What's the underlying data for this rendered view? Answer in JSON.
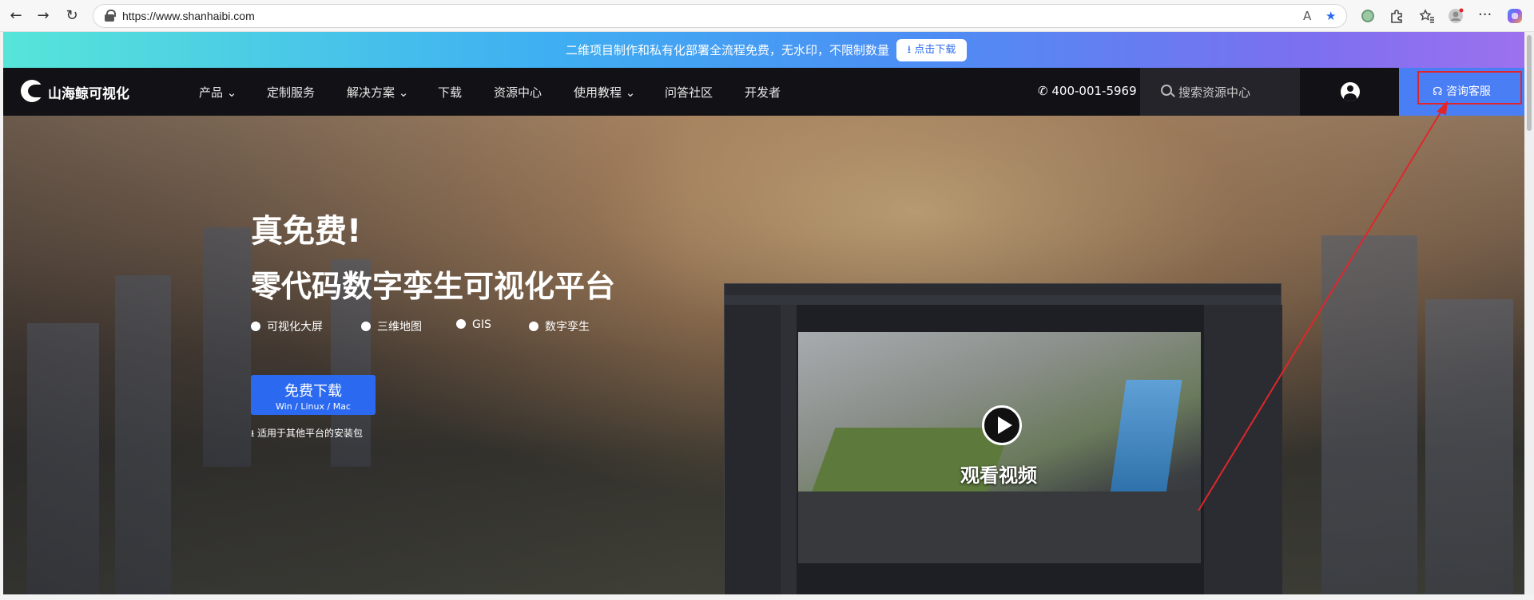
{
  "browser": {
    "url": "https://www.shanhaibi.com",
    "read_aloud_label": "A",
    "icons": [
      "back-icon",
      "forward-icon",
      "refresh-icon",
      "lock-icon",
      "read-aloud-icon",
      "favorite-star-icon",
      "extension-icon",
      "puzzle-icon",
      "favorites-icon",
      "profile-icon",
      "more-icon",
      "copilot-icon"
    ]
  },
  "promo": {
    "text": "二维项目制作和私有化部署全流程免费，无水印，不限制数量",
    "button": "点击下载"
  },
  "nav": {
    "logo": "山海鲸可视化",
    "items": [
      {
        "label": "产品",
        "dropdown": "⌄"
      },
      {
        "label": "定制服务",
        "dropdown": ""
      },
      {
        "label": "解决方案",
        "dropdown": "⌄"
      },
      {
        "label": "下载",
        "dropdown": ""
      },
      {
        "label": "资源中心",
        "dropdown": ""
      },
      {
        "label": "使用教程",
        "dropdown": "⌄"
      },
      {
        "label": "问答社区",
        "dropdown": ""
      },
      {
        "label": "开发者",
        "dropdown": ""
      }
    ],
    "phone": "400-001-5969",
    "search_placeholder": "搜索资源中心",
    "contact_button": "咨询客服"
  },
  "hero": {
    "title": "真免费!",
    "subtitle": "零代码数字孪生可视化平台",
    "features": [
      "可视化大屏",
      "三维地图",
      "GIS",
      "数字孪生"
    ],
    "download_main": "免费下载",
    "download_sub": "Win / Linux / Mac",
    "other_platforms": "适用于其他平台的安装包",
    "video_label": "观看视频"
  },
  "colors": {
    "accent": "#2b6af0",
    "nav_bg": "#121216",
    "contact_bg": "#4a7ef5",
    "annotation": "#e0262b"
  }
}
